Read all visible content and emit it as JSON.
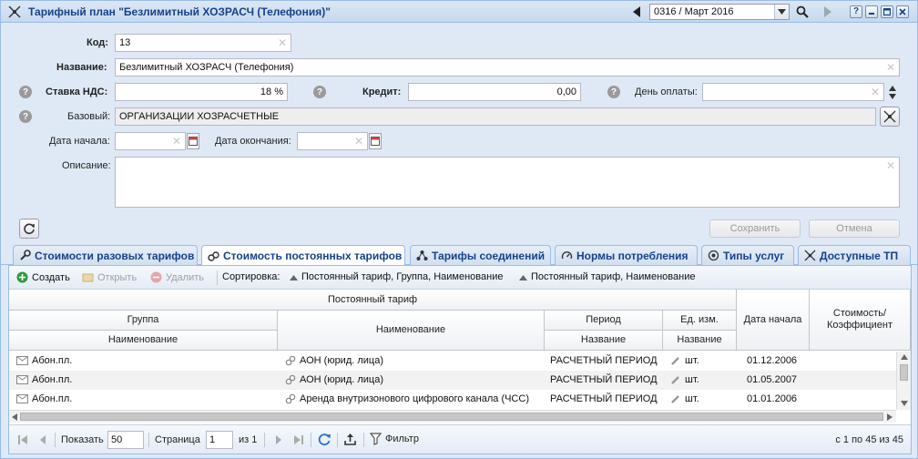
{
  "window": {
    "title": "Тарифный план \"Безлимитный ХОЗРАСЧ (Телефония)\"",
    "period": "0316 / Март 2016",
    "help_label": "?"
  },
  "form": {
    "code": {
      "label": "Код:",
      "value": "13"
    },
    "name": {
      "label": "Название:",
      "value": "Безлимитный ХОЗРАСЧ (Телефония)"
    },
    "vat": {
      "label": "Ставка НДС:",
      "value": "18 %"
    },
    "credit": {
      "label": "Кредит:",
      "value": "0,00"
    },
    "payday": {
      "label": "День оплаты:",
      "value": ""
    },
    "base": {
      "label": "Базовый:",
      "value": "ОРГАНИЗАЦИИ ХОЗРАСЧЕТНЫЕ"
    },
    "start_date": {
      "label": "Дата начала:",
      "value": ""
    },
    "end_date": {
      "label": "Дата окончания:",
      "value": ""
    },
    "description": {
      "label": "Описание:",
      "value": ""
    },
    "save_label": "Сохранить",
    "cancel_label": "Отмена"
  },
  "tabs": [
    {
      "label": "Стоимости разовых тарифов",
      "active": false
    },
    {
      "label": "Стоимость постоянных тарифов",
      "active": true
    },
    {
      "label": "Тарифы соединений",
      "active": false
    },
    {
      "label": "Нормы потребления",
      "active": false
    },
    {
      "label": "Типы услуг",
      "active": false
    },
    {
      "label": "Доступные ТП",
      "active": false
    }
  ],
  "toolbar": {
    "create": "Создать",
    "open": "Открыть",
    "delete": "Удалить",
    "sort_label": "Сортировка:",
    "sort1": "Постоянный тариф, Группа, Наименование",
    "sort2": "Постоянный тариф, Наименование"
  },
  "grid": {
    "header_group": "Постоянный тариф",
    "group": "Группа",
    "group_name": "Наименование",
    "name": "Наименование",
    "period": "Период",
    "period_name": "Название",
    "unit": "Ед. изм.",
    "unit_name": "Название",
    "start_date": "Дата начала",
    "cost_l1": "Стоимость/",
    "cost_l2": "Коэффициент",
    "rows": [
      {
        "group": "Абон.пл.",
        "name": "АОН (юрид. лица)",
        "period": "РАСЧЕТНЫЙ ПЕРИОД",
        "unit": "шт.",
        "start": "01.12.2006",
        "cost": ""
      },
      {
        "group": "Абон.пл.",
        "name": "АОН (юрид. лица)",
        "period": "РАСЧЕТНЫЙ ПЕРИОД",
        "unit": "шт.",
        "start": "01.05.2007",
        "cost": ""
      },
      {
        "group": "Абон.пл.",
        "name": "Аренда внутризонового цифрового канала (ЧСС)",
        "period": "РАСЧЕТНЫЙ ПЕРИОД",
        "unit": "шт.",
        "start": "01.01.2006",
        "cost": ""
      }
    ]
  },
  "pager": {
    "show_label": "Показать",
    "page_size": "50",
    "page_label": "Страница",
    "page": "1",
    "of_label": "из 1",
    "filter_label": "Фильтр",
    "summary": "с 1 по 45 из 45"
  }
}
